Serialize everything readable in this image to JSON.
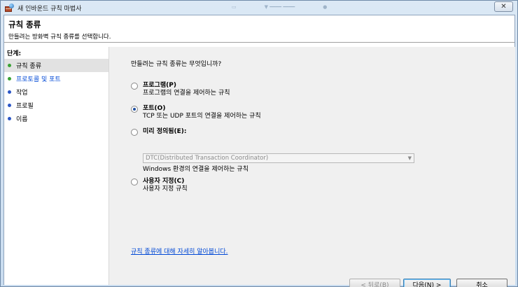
{
  "window": {
    "title": "새 인바운드 규칙 마법사",
    "close_glyph": "✕"
  },
  "header": {
    "title": "규칙 종류",
    "subtitle": "만들려는 방화벽 규칙 종류를 선택합니다."
  },
  "steps": {
    "title": "단계:",
    "items": [
      {
        "label": "규칙 종류",
        "active": true,
        "dot_color": "#3aa235"
      },
      {
        "label": "프로토콜 및 포트",
        "active": false,
        "link": true,
        "dot_color": "#3aa235"
      },
      {
        "label": "작업",
        "active": false,
        "dot_color": "#2b56c6"
      },
      {
        "label": "프로필",
        "active": false,
        "dot_color": "#2b56c6"
      },
      {
        "label": "이름",
        "active": false,
        "dot_color": "#2b56c6"
      }
    ]
  },
  "main": {
    "question": "만들려는 규칙 종류는 무엇입니까?",
    "options": [
      {
        "label": "프로그램(P)",
        "desc": "프로그램의 연결을 제어하는 규칙",
        "checked": false
      },
      {
        "label": "포트(O)",
        "desc": "TCP 또는 UDP 포트의 연결을 제어하는 규칙",
        "checked": true
      },
      {
        "label": "미리 정의됨(E):",
        "desc": "",
        "checked": false
      },
      {
        "label": "사용자 지정(C)",
        "desc": "사용자 지정 규칙",
        "checked": false
      }
    ],
    "predefined_select_value": "DTC(Distributed Transaction Coordinator)",
    "predefined_desc": "Windows 환경의 연결을 제어하는 규칙",
    "learn_more_link": "규칙 종류에 대해 자세히 알아봅니다."
  },
  "buttons": {
    "back": "< 뒤로(B)",
    "next": "다음(N) >",
    "cancel": "취소"
  }
}
